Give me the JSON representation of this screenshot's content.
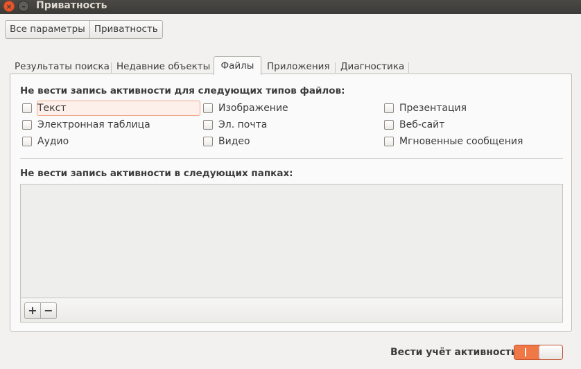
{
  "window": {
    "title": "Приватность",
    "close_glyph": "×",
    "minimize_glyph": "–"
  },
  "breadcrumb": {
    "items": [
      "Все параметры",
      "Приватность"
    ]
  },
  "tabs": [
    {
      "label": "Результаты поиска",
      "active": false
    },
    {
      "label": "Недавние объекты",
      "active": false
    },
    {
      "label": "Файлы",
      "active": true
    },
    {
      "label": "Приложения",
      "active": false
    },
    {
      "label": "Диагностика",
      "active": false
    }
  ],
  "files": {
    "types_heading": "Не вести запись активности для следующих типов файлов:",
    "file_types": [
      {
        "label": "Текст",
        "checked": false
      },
      {
        "label": "Изображение",
        "checked": false
      },
      {
        "label": "Презентация",
        "checked": false
      },
      {
        "label": "Электронная таблица",
        "checked": false
      },
      {
        "label": "Эл. почта",
        "checked": false
      },
      {
        "label": "Веб-сайт",
        "checked": false
      },
      {
        "label": "Аудио",
        "checked": false
      },
      {
        "label": "Видео",
        "checked": false
      },
      {
        "label": "Мгновенные сообщения",
        "checked": false
      }
    ],
    "folders_heading": "Не вести запись активности в следующих папках:",
    "folders": [],
    "add_button": "+",
    "remove_button": "−"
  },
  "footer": {
    "activity_label": "Вести учёт активности",
    "activity_on": true
  },
  "colors": {
    "accent": "#f07746",
    "titlebar": "#3c3b37",
    "close_button": "#e8572c"
  }
}
